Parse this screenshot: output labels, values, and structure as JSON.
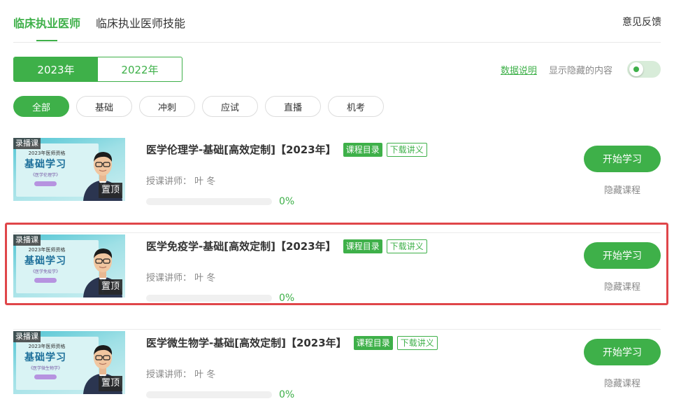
{
  "header": {
    "tabs": [
      {
        "label": "临床执业医师",
        "active": true
      },
      {
        "label": "临床执业医师技能",
        "active": false
      }
    ],
    "feedback_label": "意见反馈"
  },
  "years": [
    {
      "label": "2023年",
      "active": true
    },
    {
      "label": "2022年",
      "active": false
    }
  ],
  "toolbar": {
    "data_link": "数据说明",
    "show_hidden_label": "显示隐藏的内容",
    "show_hidden_on": true
  },
  "filters": [
    {
      "label": "全部",
      "active": true
    },
    {
      "label": "基础",
      "active": false
    },
    {
      "label": "冲刺",
      "active": false
    },
    {
      "label": "应试",
      "active": false
    },
    {
      "label": "直播",
      "active": false
    },
    {
      "label": "机考",
      "active": false
    }
  ],
  "courses": [
    {
      "title": "医学伦理学-基础[高效定制]【2023年】",
      "tag_catalog": "课程目录",
      "tag_download": "下载讲义",
      "teacher": "授课讲师：  叶   冬",
      "progress": 0,
      "progress_text": "0%",
      "start_label": "开始学习",
      "hide_label": "隐藏课程",
      "thumb": {
        "badge": "录播课",
        "year_line": "2023年医师资格",
        "big": "基础学习",
        "subject": "《医学伦理学》",
        "pin": "置顶"
      }
    },
    {
      "title": "医学免疫学-基础[高效定制]【2023年】",
      "tag_catalog": "课程目录",
      "tag_download": "下载讲义",
      "teacher": "授课讲师：  叶   冬",
      "progress": 0,
      "progress_text": "0%",
      "start_label": "开始学习",
      "hide_label": "隐藏课程",
      "thumb": {
        "badge": "录播课",
        "year_line": "2023年医师资格",
        "big": "基础学习",
        "subject": "《医学免疫学》",
        "pin": "置顶"
      }
    },
    {
      "title": "医学微生物学-基础[高效定制]【2023年】",
      "tag_catalog": "课程目录",
      "tag_download": "下载讲义",
      "teacher": "授课讲师：  叶   冬",
      "progress": 0,
      "progress_text": "0%",
      "start_label": "开始学习",
      "hide_label": "隐藏课程",
      "thumb": {
        "badge": "录播课",
        "year_line": "2023年医师资格",
        "big": "基础学习",
        "subject": "《医学微生物学》",
        "pin": "置顶"
      }
    }
  ],
  "colors": {
    "accent": "#3eb049",
    "highlight": "#e0464a"
  }
}
